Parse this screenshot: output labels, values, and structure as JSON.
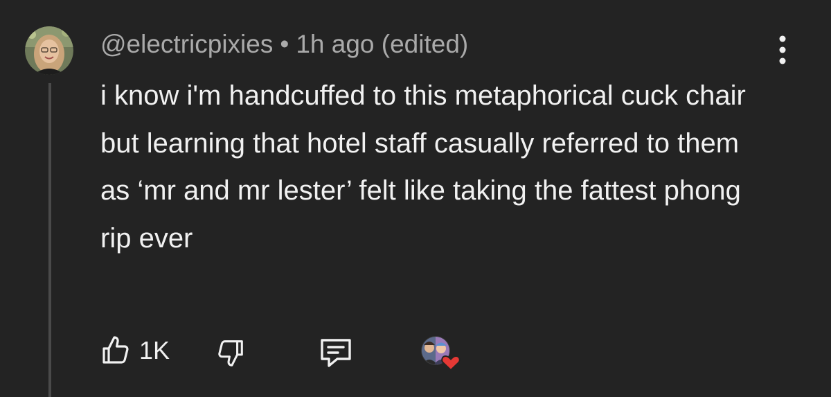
{
  "comment": {
    "username": "@electricpixies",
    "separator": "•",
    "timestamp": "1h ago (edited)",
    "text": "i know i'm handcuffed to this metaphorical cuck chair but learning that hotel staff casually referred to them as ‘mr and mr lester’ felt like taking the fattest phong rip ever",
    "likes": "1K"
  },
  "icons": {
    "avatar": "user-avatar",
    "menu": "more-vertical-icon",
    "like": "thumbs-up-icon",
    "dislike": "thumbs-down-icon",
    "reply": "comment-reply-icon",
    "creator_heart": "creator-heart-avatar"
  },
  "colors": {
    "background": "#232323",
    "text": "#f1f1f1",
    "meta": "#aaaaaa",
    "heart": "#e53935"
  }
}
